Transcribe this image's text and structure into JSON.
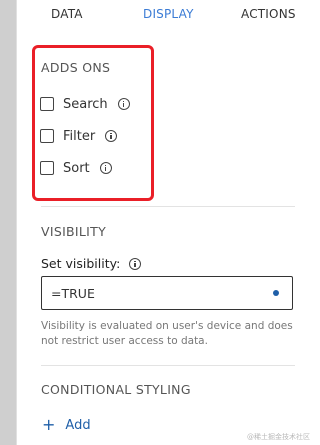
{
  "tabs": [
    {
      "label": "DATA",
      "active": false
    },
    {
      "label": "DISPLAY",
      "active": true
    },
    {
      "label": "ACTIONS",
      "active": false
    }
  ],
  "add_ons": {
    "title": "ADDS ONS",
    "items": [
      {
        "label": "Search",
        "checked": false,
        "icon": "info-icon"
      },
      {
        "label": "Filter",
        "checked": false,
        "icon": "info-icon"
      },
      {
        "label": "Sort",
        "checked": false,
        "icon": "info-icon"
      }
    ]
  },
  "visibility": {
    "title": "VISIBILITY",
    "field_label": "Set visibility:",
    "value": "=TRUE",
    "help": "Visibility is evaluated on user's device and does not restrict user access to data."
  },
  "conditional_styling": {
    "title": "CONDITIONAL STYLING",
    "add_label": "Add",
    "add_icon": "plus-icon"
  },
  "watermark": "@稀土掘金技术社区",
  "colors": {
    "accent": "#3a7bd5",
    "link": "#1f5fa8",
    "highlight": "#ea1f27"
  }
}
